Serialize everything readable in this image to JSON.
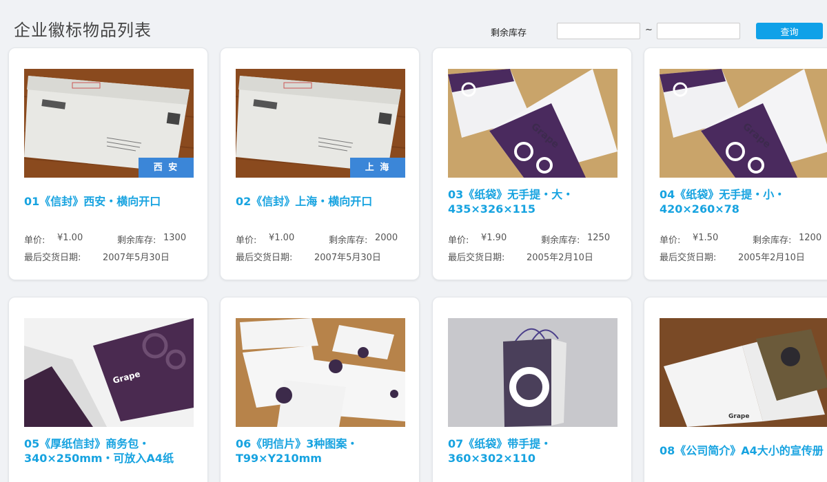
{
  "header": {
    "title": "企业徽标物品列表",
    "filter_label": "剩余库存",
    "range_separator": "~",
    "min_value": "",
    "max_value": "",
    "query_label": "查询"
  },
  "labels": {
    "price": "单价:",
    "stock": "剩余库存:",
    "delivery": "最后交货日期:"
  },
  "colors": {
    "accent": "#17a3e0",
    "button": "#0fa1e8",
    "badge": "#3b86d8"
  },
  "products": [
    {
      "name": "01《信封》西安・横向开口",
      "price": "¥1.00",
      "stock": "1300",
      "date": "2007年5月30日",
      "badge": "西 安",
      "image": "envelope-photo"
    },
    {
      "name": "02《信封》上海・横向开口",
      "price": "¥1.00",
      "stock": "2000",
      "date": "2007年5月30日",
      "badge": "上 海",
      "image": "envelope-photo"
    },
    {
      "name": "03《纸袋》无手提・大・435×326×115",
      "price": "¥1.90",
      "stock": "1250",
      "date": "2005年2月10日",
      "badge": "",
      "image": "paper-bag-photo"
    },
    {
      "name": "04《纸袋》无手提・小・420×260×78",
      "price": "¥1.50",
      "stock": "1200",
      "date": "2005年2月10日",
      "badge": "",
      "image": "paper-bag-photo"
    },
    {
      "name": "05《厚纸信封》商务包・340×250mm・可放入A4纸",
      "image": "folder-photo"
    },
    {
      "name": "06《明信片》3种图案・T99×Y210mm",
      "image": "postcard-photo"
    },
    {
      "name": "07《纸袋》带手提・360×302×110",
      "image": "shopping-bag-photo"
    },
    {
      "name": "08《公司简介》A4大小的宣传册",
      "image": "brochure-photo"
    }
  ]
}
